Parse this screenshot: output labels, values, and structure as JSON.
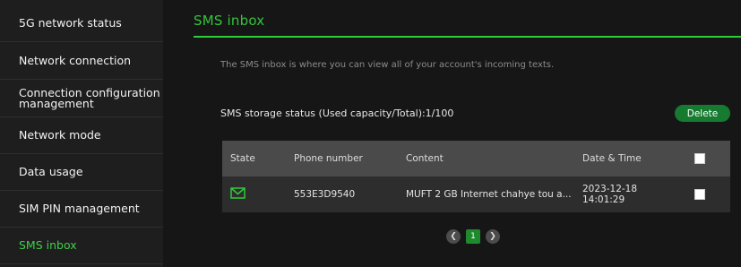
{
  "sidebar": {
    "items": [
      {
        "label": "5G network status"
      },
      {
        "label": "Network connection"
      },
      {
        "label": "Connection configuration management"
      },
      {
        "label": "Network mode"
      },
      {
        "label": "Data usage"
      },
      {
        "label": "SIM PIN management"
      },
      {
        "label": "SMS inbox",
        "active": true
      }
    ]
  },
  "main": {
    "title": "SMS inbox",
    "description": "The SMS inbox is where you can view all of your account's incoming texts.",
    "storage_status": "SMS storage status (Used capacity/Total):1/100",
    "delete_label": "Delete",
    "table": {
      "headers": {
        "state": "State",
        "phone": "Phone number",
        "content": "Content",
        "datetime": "Date & Time"
      },
      "rows": [
        {
          "state_icon": "envelope-icon",
          "phone": "553E3D9540",
          "content": "MUFT 2 GB Internet chahye tou a...",
          "date": "2023-12-18",
          "time": "14:01:29"
        }
      ]
    },
    "pagination": {
      "current": "1"
    }
  },
  "colors": {
    "accent": "#2ecc3a",
    "button": "#167a30",
    "active_text": "#3fd046"
  }
}
